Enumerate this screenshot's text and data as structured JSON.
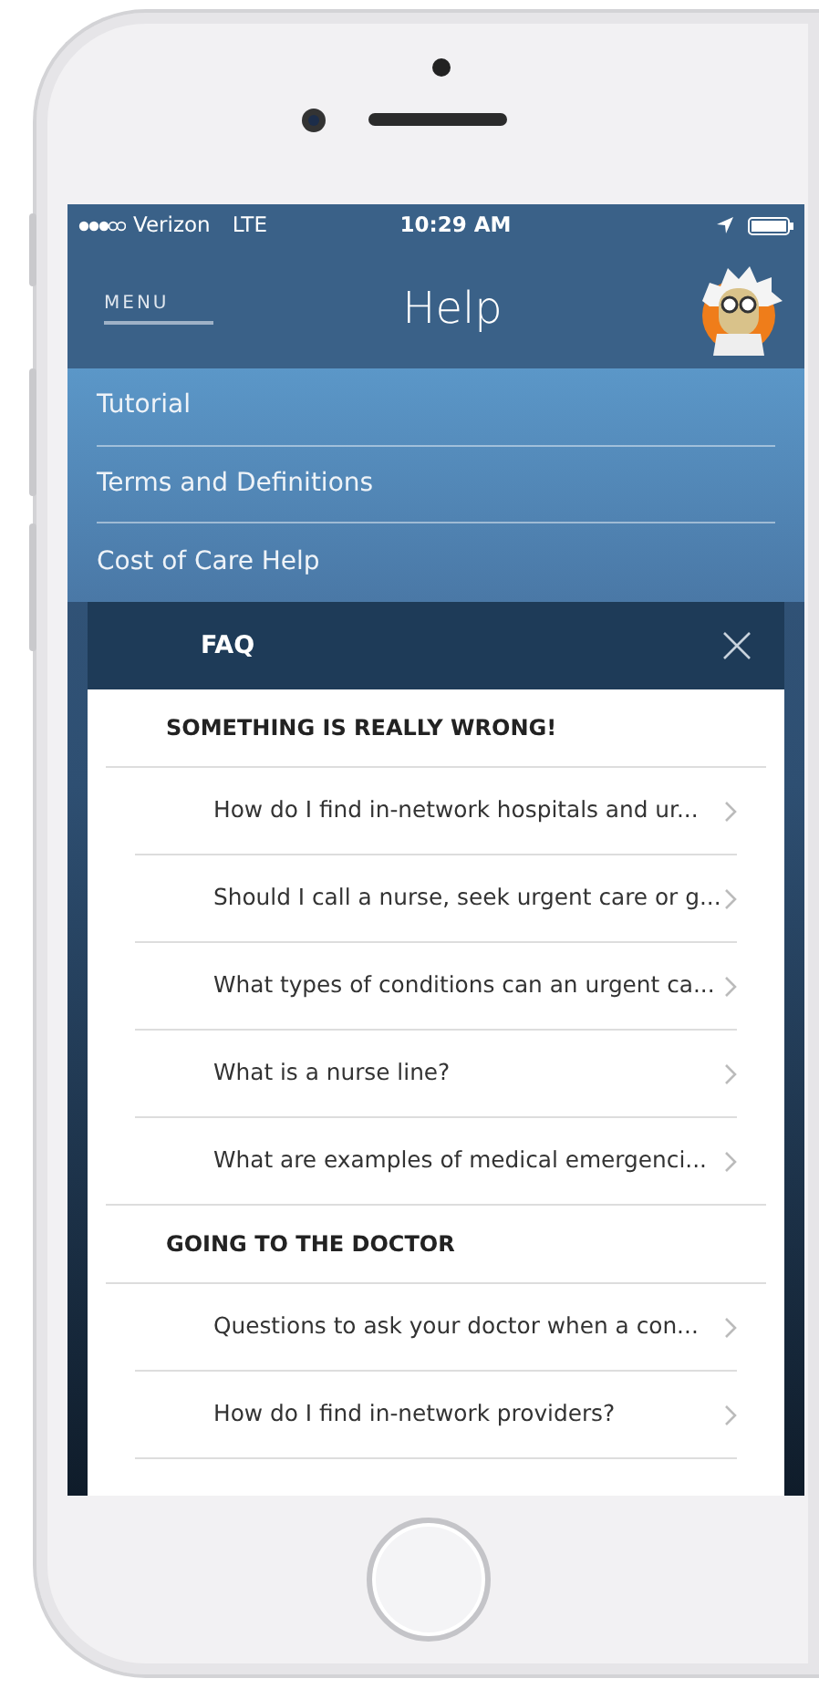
{
  "status_bar": {
    "carrier": "Verizon",
    "network": "LTE",
    "time": "10:29 AM"
  },
  "header": {
    "menu": "MENU",
    "title": "Help"
  },
  "menu_items": [
    {
      "label": "Tutorial"
    },
    {
      "label": "Terms and Definitions"
    },
    {
      "label": "Cost of Care Help"
    }
  ],
  "faq": {
    "title": "FAQ",
    "sections": [
      {
        "title": "SOMETHING IS REALLY WRONG!",
        "questions": [
          "How do I find in-network hospitals and ur...",
          "Should I call a nurse, seek urgent care or g...",
          "What types of conditions can an urgent ca...",
          "What is a nurse line?",
          "What are examples of medical emergenci..."
        ]
      },
      {
        "title": "GOING TO THE DOCTOR",
        "questions": [
          "Questions to ask your doctor when a con...",
          "How do I find in-network providers?"
        ]
      }
    ]
  }
}
